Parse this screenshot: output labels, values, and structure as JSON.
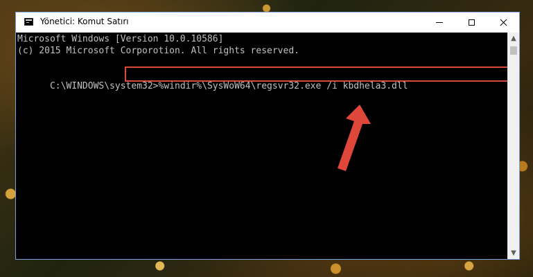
{
  "window": {
    "title": "Yönetici: Komut Satırı",
    "buttons": {
      "minimize": "minimize-icon",
      "maximize": "maximize-icon",
      "close": "close-icon"
    }
  },
  "console": {
    "lines": [
      "Microsoft Windows [Version 10.0.10586]",
      "(c) 2015 Microsoft Corporotion. All rights reserved."
    ],
    "prompt": "C:\\WINDOWS\\system32>",
    "command": "%windir%\\SysWoW64\\regsvr32.exe /i kbdhela3.dll"
  },
  "colors": {
    "highlight": "#d94a3a",
    "arrow": "#e0473b",
    "console_bg": "#000000",
    "console_text": "#c0c0c0"
  }
}
